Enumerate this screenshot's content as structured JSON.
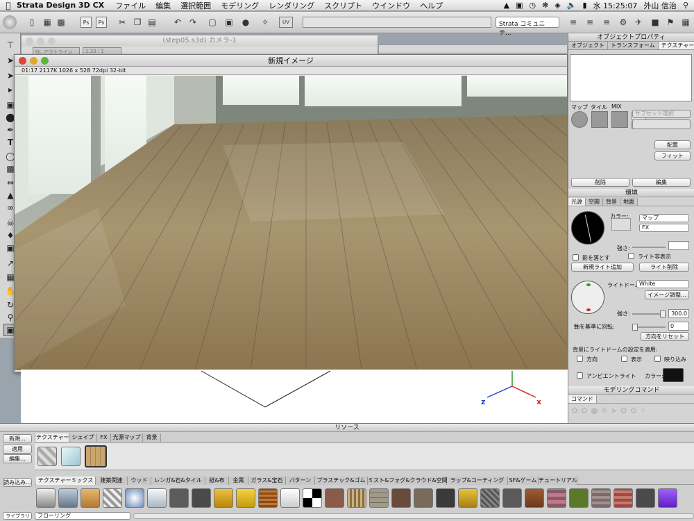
{
  "menubar": {
    "app": "Strata Design 3D CX",
    "items": [
      "ファイル",
      "編集",
      "選択範囲",
      "モデリング",
      "レンダリング",
      "スクリプト",
      "ウインドウ",
      "ヘルプ"
    ],
    "clock": "水 15:25:07",
    "user": "外山 信治"
  },
  "toolbar": {
    "community": "Strata コミュニテ..."
  },
  "camera_window": {
    "title": "(step05.s3d) カメラ-1",
    "mode": "GL アウトライン",
    "ratio": "1.33 : 1"
  },
  "render_window": {
    "title": "新規イメージ",
    "info": "01:17   2117K   1026 x 528   72dpi   32-bit"
  },
  "object_props": {
    "title": "オブジェクトプロパティ",
    "tabs": [
      "オブジェクト",
      "トランスフォーム",
      "テクスチャー"
    ],
    "map_labels": [
      "マップ",
      "タイル",
      "MIX"
    ],
    "swap": "交換",
    "subset": "サブセット選択",
    "place": "配置",
    "fit": "フィット",
    "delete": "削除",
    "edit": "編集"
  },
  "environment": {
    "title": "環境",
    "tabs": [
      "光源",
      "空間",
      "背景",
      "地面"
    ],
    "color_label": "カラー:",
    "map": "マップ",
    "fx": "FX",
    "strength_label": "強さ:",
    "cast_shadow": "影を落とす",
    "light_hidden": "ライト非表示",
    "add_light": "新規ライト追加",
    "delete_light": "ライト削除",
    "lightdome_label": "ライトドーム:",
    "lightdome_value": "White",
    "image_adjust": "イメージ調整...",
    "strength_value": "300.0",
    "rotate_label": "軸を基準に回転:",
    "rotate_value": "0",
    "reset_dir": "方向をリセット",
    "apply_bg": "背景にライトドームの設定を適用:",
    "dir": "方向",
    "show": "表示",
    "reflect": "映り込み",
    "ambient": "アンビエントライト",
    "color2": "カラー:"
  },
  "modeling": {
    "title": "モデリングコマンド",
    "tab": "コマンド"
  },
  "resources": {
    "title": "リソース",
    "buttons": [
      "新規...",
      "適用",
      "編集...",
      "読み込み..."
    ],
    "tabs": [
      "テクスチャー",
      "シェイプ",
      "FX",
      "光源マップ",
      "背景"
    ],
    "categories": [
      "テクスチャーミックス",
      "建築関連",
      "ウッド",
      "レンガ&石&タイル",
      "紙&布",
      "金属",
      "ガラス&宝石",
      "パターン",
      "プラスチック&ゴム",
      "ミスト&フォグ&クラウド&空間",
      "ラップ&コーティング",
      "SF&ゲーム",
      "チュートリアル"
    ],
    "library": "ライブラリ",
    "library_value": "フローリング"
  },
  "colors": {
    "floor": "#a08a62",
    "accent": "#3a6fd0"
  }
}
